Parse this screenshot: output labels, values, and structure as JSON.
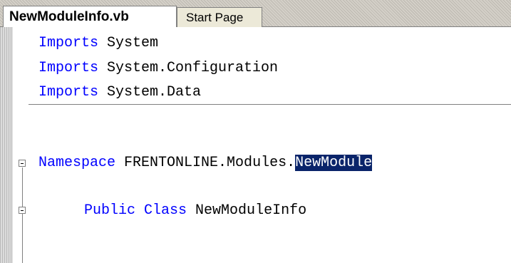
{
  "tabs": [
    {
      "label": "NewModuleInfo.vb",
      "active": true
    },
    {
      "label": "Start Page",
      "active": false
    }
  ],
  "code": {
    "line1": {
      "keyword": "Imports",
      "rest": " System"
    },
    "line2": {
      "keyword": "Imports",
      "rest": " System.Configuration"
    },
    "line3": {
      "keyword": "Imports",
      "rest": " System.Data"
    },
    "line4": {
      "keyword": "Namespace",
      "rest": " FRENTONLINE.Modules.",
      "selected": "NewModule"
    },
    "line5": {
      "keyword1": "Public",
      "keyword2": "Class",
      "rest": " NewModuleInfo"
    }
  },
  "colors": {
    "keyword": "#0000ff",
    "selection": "#0a246a"
  }
}
